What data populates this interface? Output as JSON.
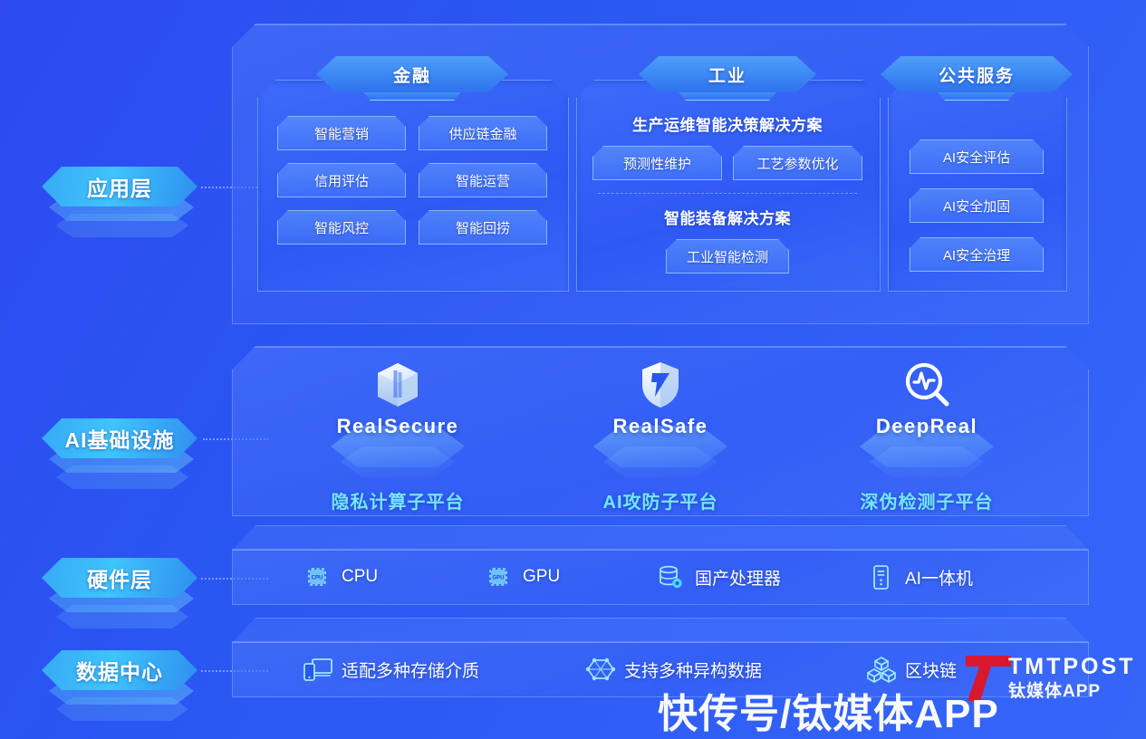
{
  "layers": [
    {
      "id": "application",
      "label": "应用层"
    },
    {
      "id": "ai-infrastructure",
      "label": "AI基础设施"
    },
    {
      "id": "hardware",
      "label": "硬件层"
    },
    {
      "id": "data-center",
      "label": "数据中心"
    }
  ],
  "application": {
    "columns": [
      {
        "id": "finance",
        "tab": "金融",
        "chips": [
          "智能营销",
          "供应链金融",
          "信用评估",
          "智能运营",
          "智能风控",
          "智能回捞"
        ]
      },
      {
        "id": "industry",
        "tab": "工业",
        "solutions": [
          {
            "title": "生产运维智能决策解决方案",
            "chips": [
              "预测性维护",
              "工艺参数优化"
            ]
          },
          {
            "title": "智能装备解决方案",
            "chips": [
              "工业智能检测"
            ]
          }
        ]
      },
      {
        "id": "public-service",
        "tab": "公共服务",
        "chips": [
          "AI安全评估",
          "AI安全加固",
          "AI安全治理"
        ]
      }
    ]
  },
  "infrastructure": {
    "items": [
      {
        "id": "realsecure",
        "logo_icon": "cube-icon",
        "brand": "RealSecure",
        "caption": "隐私计算子平台"
      },
      {
        "id": "realsafe",
        "logo_icon": "shield-icon",
        "brand": "RealSafe",
        "caption": "AI攻防子平台"
      },
      {
        "id": "deepreal",
        "logo_icon": "magnifier-pulse-icon",
        "brand": "DeepReal",
        "caption": "深伪检测子平台"
      }
    ]
  },
  "hardware": {
    "items": [
      {
        "id": "cpu",
        "icon": "cpu-chip-icon",
        "icon_text": "CPU",
        "label": "CPU"
      },
      {
        "id": "gpu",
        "icon": "gpu-chip-icon",
        "icon_text": "GPU",
        "label": "GPU"
      },
      {
        "id": "domestic-processor",
        "icon": "database-gear-icon",
        "label": "国产处理器"
      },
      {
        "id": "ai-appliance",
        "icon": "server-tower-icon",
        "label": "AI一体机"
      }
    ]
  },
  "data_center": {
    "items": [
      {
        "id": "storage-media",
        "icon": "devices-icon",
        "label": "适配多种存储介质"
      },
      {
        "id": "heterogeneous-data",
        "icon": "graph-nodes-icon",
        "label": "支持多种异构数据"
      },
      {
        "id": "blockchain",
        "icon": "blocks-icon",
        "label": "区块链"
      }
    ]
  },
  "watermarks": {
    "big": "快传号/钛媒体APP",
    "brand": "TMTPOST",
    "brand_sub": "钛媒体APP",
    "logo_icon": "tmtpost-logo-icon"
  },
  "colors": {
    "background_start": "#2d4bf0",
    "background_end": "#3566f8",
    "accent_cyan": "#74e6ff",
    "tab_blue": "#3f8df5",
    "badge_blue": "#3fc4fb",
    "watermark_red": "#d8182f"
  }
}
